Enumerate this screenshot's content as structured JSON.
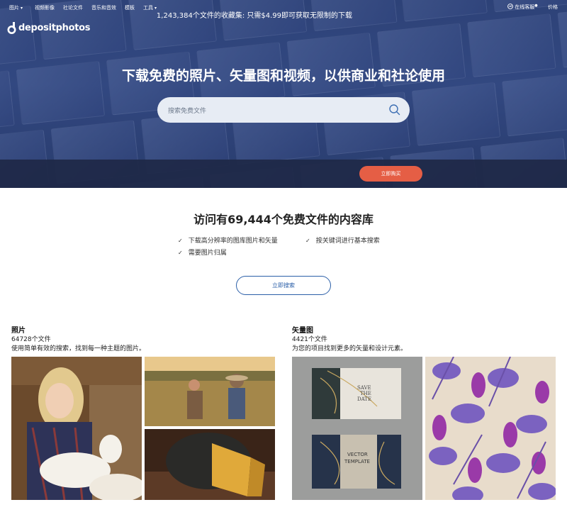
{
  "nav": {
    "left": [
      {
        "label": "图片",
        "dropdown": true
      },
      {
        "label": "视频影像",
        "dropdown": false
      },
      {
        "label": "社论文件",
        "dropdown": false
      },
      {
        "label": "音乐和音效",
        "dropdown": false
      },
      {
        "label": "模板",
        "dropdown": false
      },
      {
        "label": "工具",
        "dropdown": true
      }
    ],
    "support_label": "在线客服",
    "pricing_label": "价格"
  },
  "logo_text": "depositphotos",
  "hero": {
    "title": "下载免费的照片、矢量图和视频，以供商业和社论使用",
    "search_placeholder": "搜索免费文件"
  },
  "promo": {
    "text": "1,243,384个文件的收藏集: 只需$4.99即可获取无限制的下载",
    "button": "立即购买"
  },
  "library": {
    "title": "访问有69,444个免费文件的内容库",
    "features": [
      "下载高分辨率的图库图片和矢量",
      "按关键词进行基本搜索",
      "需要图片归属"
    ],
    "button": "立即搜索"
  },
  "categories": [
    {
      "title": "照片",
      "count": "64728个文件",
      "desc": "使用简单有效的搜索，找到每一种主题的图片。"
    },
    {
      "title": "矢量图",
      "count": "4421个文件",
      "desc": "为您的项目找到更多的矢量和设计元素。"
    }
  ],
  "colors": {
    "accent": "#e55e45",
    "link": "#2b5fa8",
    "hero": "#3b528c"
  }
}
